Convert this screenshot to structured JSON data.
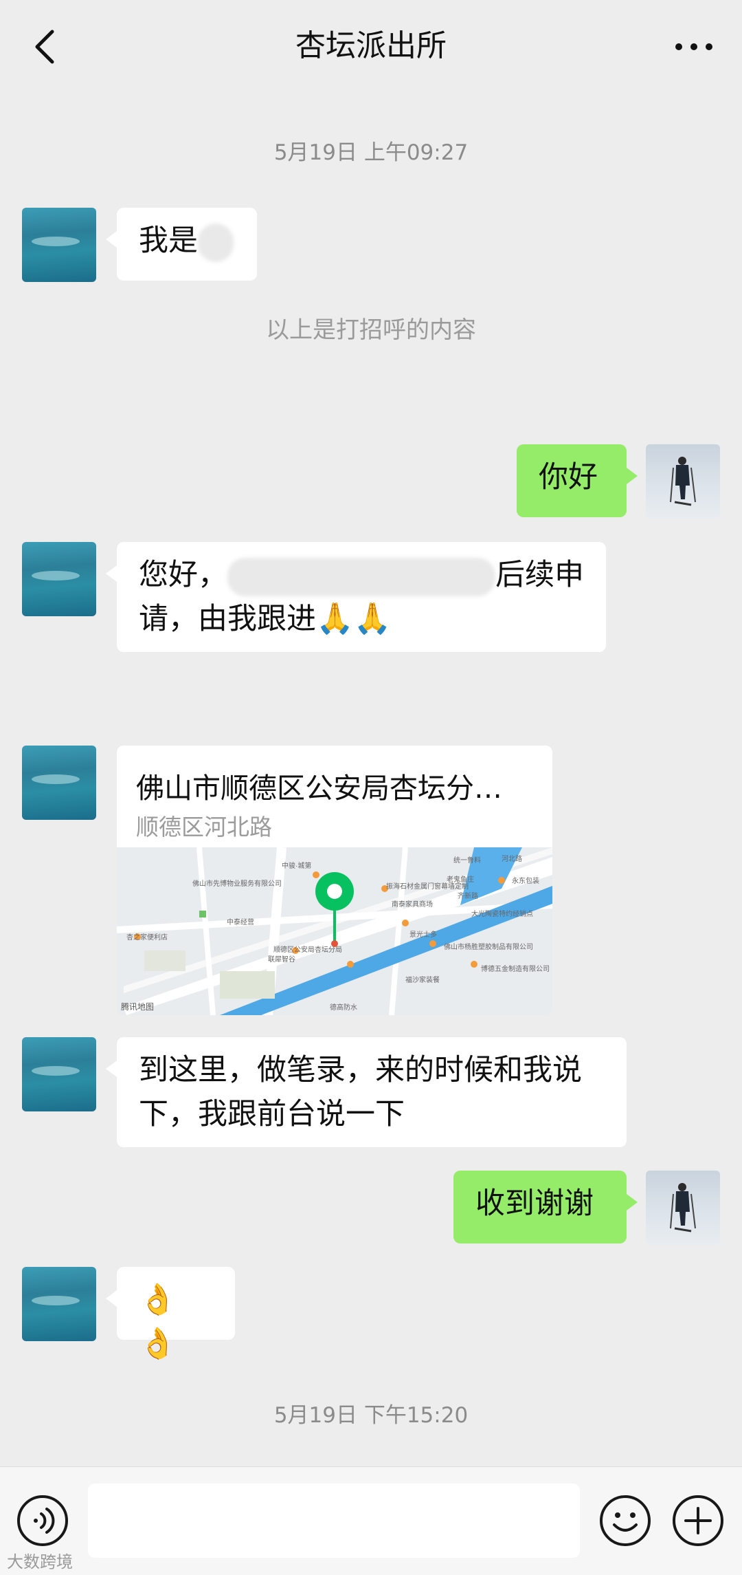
{
  "header": {
    "title": "杏坛派出所"
  },
  "timestamps": [
    "5月19日 上午09:27",
    "5月19日 下午15:20"
  ],
  "system_message": "以上是打招呼的内容",
  "messages": [
    {
      "side": "in",
      "text": "我是"
    },
    {
      "side": "out",
      "text": "你好"
    },
    {
      "side": "in",
      "text_part1": "您好，",
      "text_part2": "后续申请，由我跟进",
      "emoji": "🙏🙏"
    },
    {
      "side": "in",
      "text": "到这里，做笔录，来的时候和我说下，我跟前台说一下"
    },
    {
      "side": "out",
      "text": "收到谢谢"
    },
    {
      "side": "in",
      "emoji": "👌👌"
    }
  ],
  "location": {
    "title": "佛山市顺德区公安局杏坛分…",
    "address": "顺德区河北路",
    "map_provider": "腾讯地图",
    "map_labels": [
      "佛山市先博物业服务有限公司",
      "振海石材金属门窗幕墙定制",
      "中骏·城第",
      "统一鲁料",
      "永东包装",
      "老鬼鱼庄",
      "南泰家具商场",
      "大光陶瓷特约经销点",
      "顺德区公安局杏坛分局",
      "佛山市杨胜塑胶制品有限公司",
      "景光士多",
      "福沙家装餐",
      "博德五金制造有限公司",
      "杏之家便利店",
      "联犀智谷",
      "德高防水",
      "中泰经营",
      "河北路",
      "齐新路"
    ]
  },
  "watermark": "大数跨境",
  "colors": {
    "background": "#ededed",
    "outgoing_bubble": "#95ec69",
    "incoming_bubble": "#ffffff",
    "map_pin": "#07c160"
  }
}
